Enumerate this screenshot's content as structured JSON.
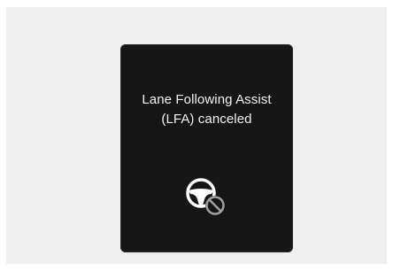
{
  "notification": {
    "line1": "Lane Following Assist",
    "line2": "(LFA) canceled",
    "icon": "steering-wheel-disabled-icon"
  },
  "colors": {
    "panel_background": "#161616",
    "text": "#f2f2f2",
    "icon": "#ffffff",
    "prohibit_icon": "#9a9a9a"
  }
}
